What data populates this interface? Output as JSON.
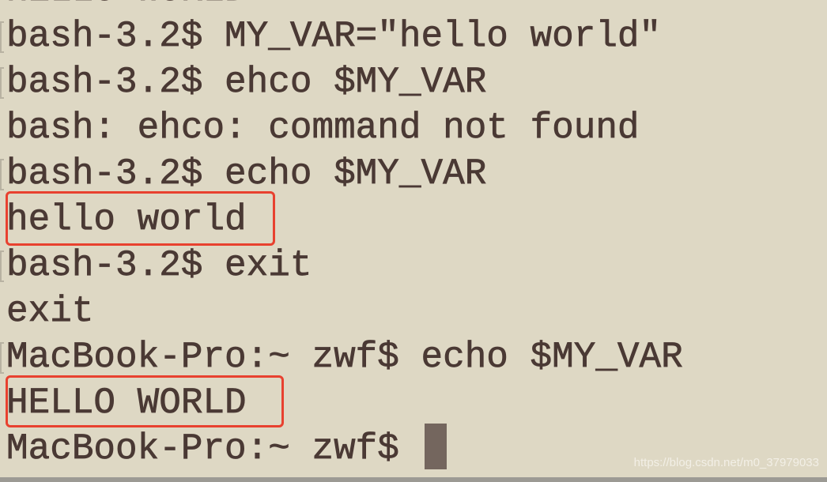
{
  "terminal": {
    "lines": [
      "HELLO WORLD",
      "bash-3.2$ MY_VAR=\"hello world\"",
      "bash-3.2$ ehco $MY_VAR",
      "bash: ehco: command not found",
      "bash-3.2$ echo $MY_VAR",
      "hello world",
      "bash-3.2$ exit",
      "exit",
      "MacBook-Pro:~ zwf$ echo $MY_VAR",
      "HELLO WORLD",
      "MacBook-Pro:~ zwf$ "
    ],
    "highlight_color": "#e8412f",
    "background_color": "#ded8c4",
    "text_color": "#4a3934"
  },
  "watermark": "https://blog.csdn.net/m0_37979033"
}
